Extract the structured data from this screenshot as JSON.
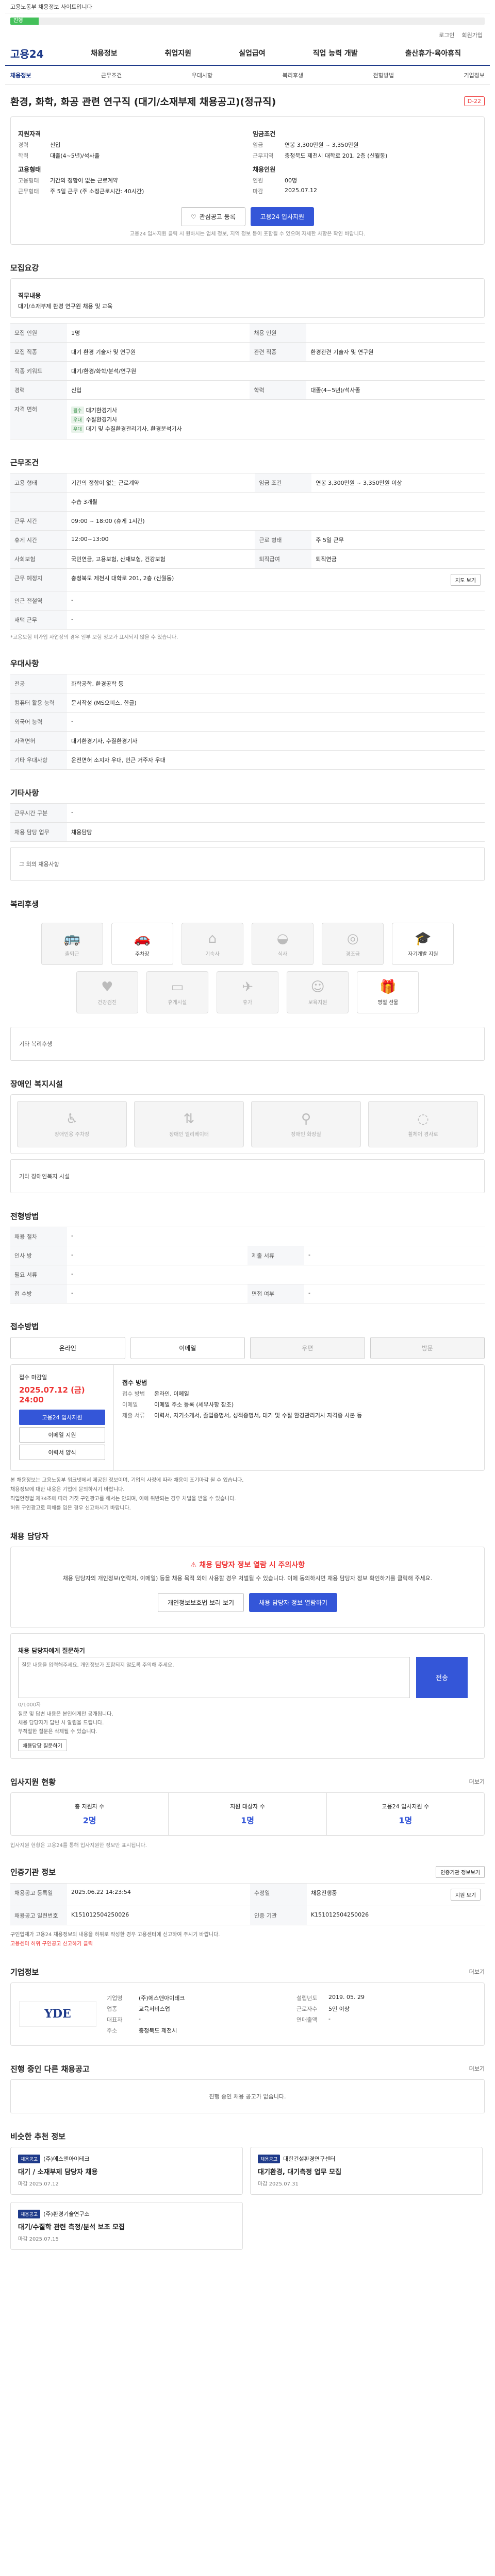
{
  "topstrip": "고용노동부 채용정보 사이트입니다",
  "progress": {
    "label": "진행",
    "fraction": 0.06
  },
  "util": [
    "로그인",
    "회원가입"
  ],
  "gnb": {
    "logo": "고용24",
    "menu": [
      "채용정보",
      "취업지원",
      "실업급여",
      "직업 능력 개발",
      "출산휴가·육아휴직"
    ]
  },
  "tabs": [
    "채용정보",
    "근무조건",
    "우대사항",
    "복리후생",
    "전형방법",
    "기업정보"
  ],
  "header": {
    "title": "환경, 화학, 화공 관련 연구직 (대기/소재부제 채용공고)(정규직)",
    "dday": "D-22"
  },
  "summary": {
    "left_title": "지원자격",
    "left": [
      {
        "k": "경력",
        "v": "신입"
      },
      {
        "k": "학력",
        "v": "대졸(4~5년)/석사졸"
      }
    ],
    "left2_title": "고용형태",
    "left2": [
      {
        "k": "고용형태",
        "v": "기간의 정함이 없는 근로계약"
      },
      {
        "k": "근무형태",
        "v": "주 5일 근무 (주 소정근로시간: 40시간)"
      }
    ],
    "right_title": "임금조건",
    "right": [
      {
        "k": "임금",
        "v": "연봉 3,300만원 ~ 3,350만원"
      },
      {
        "k": "근무지역",
        "v": "충청북도 제천시 대학로 201, 2층 (신월동)"
      }
    ],
    "right2_title": "채용인원",
    "right2": [
      {
        "k": "인원",
        "v": "00명"
      },
      {
        "k": "마감",
        "v": "2025.07.12"
      }
    ],
    "btn_scrap": "관심공고 등록",
    "btn_apply": "고용24 입사지원",
    "note": "고용24 입사지원 클릭 시 원하시는 업체 정보, 지역 정보 등이 포함될 수 있으며 자세한 사항은 확인 바랍니다."
  },
  "recruit": {
    "title": "모집요강",
    "duty_label": "직무내용",
    "duty": "대기/소재부제 환경 연구원 채용 및 교육",
    "rows": [
      {
        "k": "모집 인원",
        "v": "1명",
        "k2": "채용 인원",
        "v2": ""
      },
      {
        "k": "모집 직종",
        "v": "대기 환경 기술자 및 연구원",
        "k2": "관련 직종",
        "v2": "환경관련 기술자 및 연구원"
      },
      {
        "k": "직종 키워드",
        "v": "대기/환경/화학/분석/연구원",
        "k2": "",
        "v2": ""
      },
      {
        "k": "경력",
        "v": "신입",
        "k2": "학력",
        "v2": "대졸(4~5년)/석사졸"
      }
    ],
    "cert_label": "자격 면허",
    "certs": [
      {
        "chip": "필수",
        "t": "대기환경기사"
      },
      {
        "chip": "우대",
        "t": "수질환경기사"
      },
      {
        "chip": "우대",
        "t": "대기 및 수질환경관리기사, 환경분석기사"
      }
    ]
  },
  "condition": {
    "title": "근무조건",
    "rows": [
      {
        "k": "고용 형태",
        "v": "기간의 정함이 없는 근로계약",
        "k2": "임금 조건",
        "v2": "연봉 3,300만원 ~ 3,350만원 이상"
      },
      {
        "k": "",
        "v": "수습 3개월",
        "k2": "",
        "v2": ""
      },
      {
        "k": "근무 시간",
        "v": "09:00 ~ 18:00 (휴게 1시간)",
        "k2": "",
        "v2": ""
      },
      {
        "k": "휴게 시간",
        "v": "12:00~13:00",
        "k2": "근로 형태",
        "v2": "주 5일 근무"
      },
      {
        "k": "사회보험",
        "v": "국민연금, 고용보험, 산재보험, 건강보험",
        "k2": "퇴직급여",
        "v2": "퇴직연금"
      },
      {
        "k": "근무 예정지",
        "v": "충청북도 제천시 대학로 201, 2층 (신월동)",
        "k2": "",
        "v2": ""
      },
      {
        "k": "인근 전철역",
        "v": "-",
        "k2": "",
        "v2": ""
      },
      {
        "k": "재택 근무",
        "v": "-",
        "k2": "",
        "v2": ""
      }
    ],
    "map_btn": "지도 보기",
    "footnote": "*고용보험 미가입 사업장의 경우 일부 보험 정보가 표시되지 않을 수 있습니다."
  },
  "prefer": {
    "title": "우대사항",
    "rows": [
      {
        "k": "전공",
        "v": "화학공학, 환경공학 등"
      },
      {
        "k": "컴퓨터 활용 능력",
        "v": "문서작성 (MS오피스, 한글)"
      },
      {
        "k": "외국어 능력",
        "v": "-"
      },
      {
        "k": "자격면허",
        "v": "대기환경기사, 수질환경기사"
      },
      {
        "k": "기타 우대사항",
        "v": "운전면허 소지자 우대, 인근 거주자 우대"
      }
    ]
  },
  "etc": {
    "title": "기타사항",
    "rows": [
      {
        "k": "근무시간 구분",
        "v": "-"
      },
      {
        "k": "채용 담당 업무",
        "v": "채용담당"
      }
    ],
    "note": "그 외의 채용사항"
  },
  "welfare": {
    "title": "복리후생",
    "items": [
      {
        "icon": "bus-icon",
        "label": "출퇴근",
        "dim": true
      },
      {
        "icon": "car-icon",
        "label": "주차장",
        "dim": false
      },
      {
        "icon": "house-icon",
        "label": "기숙사",
        "dim": true
      },
      {
        "icon": "meal-icon",
        "label": "식사",
        "dim": true
      },
      {
        "icon": "coin-icon",
        "label": "경조금",
        "dim": true
      },
      {
        "icon": "cap-icon",
        "label": "자기개발 지원",
        "dim": false
      },
      {
        "icon": "heart-icon",
        "label": "건강검진",
        "dim": true
      },
      {
        "icon": "sofa-icon",
        "label": "휴게시설",
        "dim": true
      },
      {
        "icon": "plane-icon",
        "label": "휴가",
        "dim": true
      },
      {
        "icon": "baby-icon",
        "label": "보육지원",
        "dim": true
      },
      {
        "icon": "gift-icon",
        "label": "명절 선물",
        "dim": false
      }
    ],
    "extra": "기타 복리후생"
  },
  "disabled": {
    "title": "장애인 복지시설",
    "items": [
      {
        "icon": "ramp-icon",
        "label": "장애인용 주차장"
      },
      {
        "icon": "elevator-icon",
        "label": "장애인 엘리베이터"
      },
      {
        "icon": "toilet-icon",
        "label": "장애인 화장실"
      },
      {
        "icon": "wheel-icon",
        "label": "휠체어 경사로"
      }
    ],
    "extra": "기타 장애인복지 시설"
  },
  "selection": {
    "title": "전형방법",
    "rows": [
      {
        "k": "채용 절차",
        "v": "-",
        "k2": "",
        "v2": ""
      },
      {
        "k": "인사 방",
        "v": "-",
        "k2": "제출 서류",
        "v2": "-"
      },
      {
        "k": "필요 서류",
        "v": "-",
        "k2": "",
        "v2": ""
      },
      {
        "k": "접 수방",
        "v": "-",
        "k2": "면접 여부",
        "v2": "-"
      }
    ]
  },
  "method": {
    "title": "접수방법",
    "items": [
      {
        "label": "온라인",
        "dim": false
      },
      {
        "label": "이메일",
        "dim": false
      },
      {
        "label": "우편",
        "dim": true
      },
      {
        "label": "방문",
        "dim": true
      }
    ]
  },
  "applyinfo": {
    "left_label": "접수 마감일",
    "deadline": "2025.07.12 (금) 24:00",
    "b1": "고용24 입사지원",
    "b2": "이메일 지원",
    "b3": "이력서 양식",
    "right_label": "접수 방법",
    "rows": [
      {
        "k": "접수 방법",
        "v": "온라인, 이메일"
      },
      {
        "k": "이메일",
        "v": "이메일 주소 등록 (세부사항 참조)"
      },
      {
        "k": "제출 서류",
        "v": "이력서, 자기소개서, 졸업증명서, 성적증명서, 대기 및 수질 환경관리기사 자격증 사본 등"
      }
    ]
  },
  "bullets": [
    "본 채용정보는 고용노동부 워크넷에서 제공된 정보이며, 기업의 사정에 따라 채용이 조기마감 될 수 있습니다.",
    "채용정보에 대한 내용은 기업에 문의하시기 바랍니다.",
    "직업안정법 제34조에 따라 거짓 구인광고를 해서는 안되며, 이에 위반되는 경우 처벌을 받을 수 있습니다.",
    "허위 구인광고로 피해를 입은 경우 신고하시기 바랍니다."
  ],
  "contact": {
    "title": "채용 담당자",
    "warn_title": "채용 담당자 정보 열람 시 주의사항",
    "warn_desc": "채용 담당자의 개인정보(연락처, 이메일) 등을 채용 목적 외에 사용할 경우 처벌될 수 있습니다. 이에 동의하시면 채용 담당자 정보 확인하기를 클릭해 주세요.",
    "btn1": "개인정보보호법 보러 보기",
    "btn2": "채용 담당자 정보 열람하기"
  },
  "qa": {
    "title": "채용 담당자에게 질문하기",
    "placeholder": "질문 내용을 입력해주세요. 개인정보가 포함되지 않도록 주의해 주세요.",
    "counter": "0/1000자",
    "send": "전송",
    "sub_btn": "채용담당 질문하기",
    "notes": [
      "질문 및 답변 내용은 본인에게만 공개됩니다.",
      "채용 담당자가 답변 시 알림을 드립니다.",
      "부적절한 질문은 삭제될 수 있습니다."
    ]
  },
  "stats": {
    "title": "입사지원 현황",
    "more": "더보기",
    "items": [
      {
        "label": "총 지원자 수",
        "n": "2명"
      },
      {
        "label": "지원 대상자 수",
        "n": "1명"
      },
      {
        "label": "고용24 입사지원 수",
        "n": "1명"
      }
    ],
    "note": "입사지원 현황은 고용24를 통해 입사지원한 정보만 표시됩니다."
  },
  "cert": {
    "title": "인증기관 정보",
    "btn": "인증기관 정보보기",
    "rows": [
      {
        "k": "채용공고 등록일",
        "v": "2025.06.22 14:23:54",
        "k2": "수정일",
        "v2": "채용진행중"
      },
      {
        "k": "채용공고 일련번호",
        "v": "K151012504250026",
        "k2": "인증 기관",
        "v2": "K151012504250026"
      }
    ],
    "btn_more": "지원 보기",
    "notes": [
      "구인업체가 고용24 채용정보의 내용을 허위로 작성한 경우 고용센터에 신고하여 주시기 바랍니다.",
      "고용센터 허위 구인공고 신고하기 클릭"
    ]
  },
  "company": {
    "title": "기업정보",
    "more": "더보기",
    "logo": "YDE",
    "rows": [
      {
        "k": "기업명",
        "v": "(주)에스앤아이테크",
        "k2": "설립년도",
        "v2": "2019. 05. 29"
      },
      {
        "k": "업종",
        "v": "교육서비스업",
        "k2": "근로자수",
        "v2": "5인 이상"
      },
      {
        "k": "대표자",
        "v": "-",
        "k2": "연매출액",
        "v2": "-"
      },
      {
        "k": "주소",
        "v": "충청북도 제천시",
        "k2": "",
        "v2": ""
      }
    ]
  },
  "ongoing": {
    "title": "진행 중인 다른 채용공고",
    "more": "더보기",
    "empty": "진행 중인 채용 공고가 없습니다."
  },
  "recommend": {
    "title": "비슷한 추천 정보",
    "cards": [
      {
        "tag": "채용공고",
        "company": "(주)에스앤아이테크",
        "title": "대기 / 소재부제 담당자 채용",
        "date": "마감 2025.07.12"
      },
      {
        "tag": "채용공고",
        "company": "대한건설환경연구센터",
        "title": "대기환경, 대기측정 업무 모집",
        "date": "마감 2025.07.31"
      },
      {
        "tag": "채용공고",
        "company": "(주)환경기술연구소",
        "title": "대기/수질학 관련 측정/분석 보조 모집",
        "date": "마감 2025.07.15"
      }
    ]
  }
}
